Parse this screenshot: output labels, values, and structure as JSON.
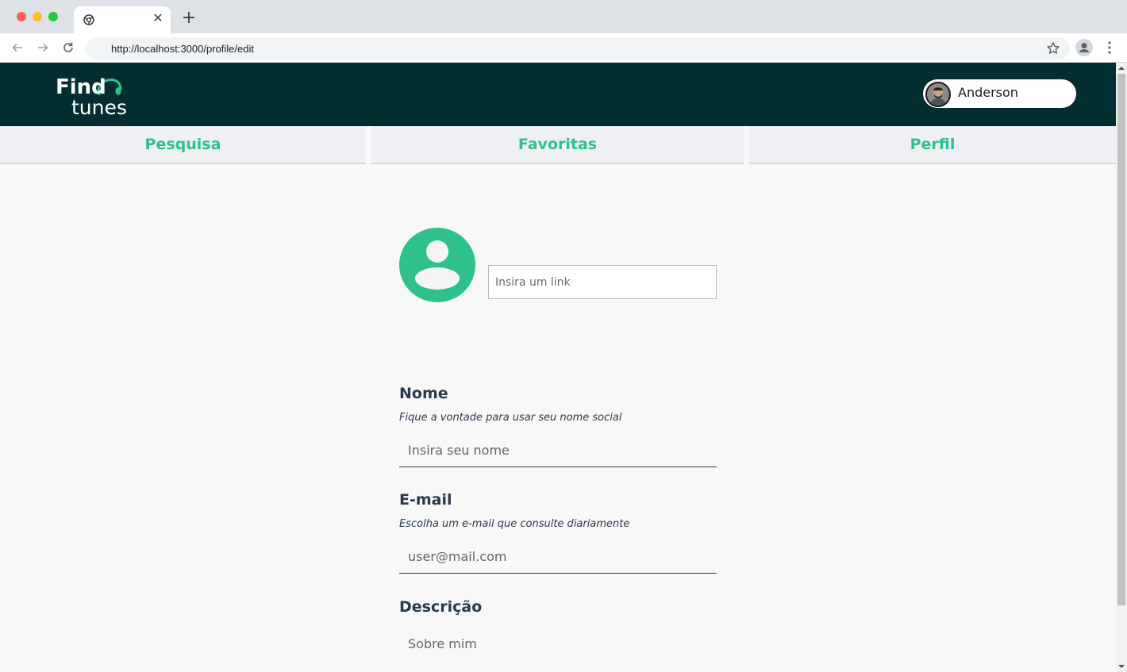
{
  "browser": {
    "url": "http://localhost:3000/profile/edit",
    "tab_close": "✕",
    "new_tab": "+"
  },
  "header": {
    "logo_line1": "Find",
    "logo_line2": "tunes",
    "user_name": "Anderson"
  },
  "nav": {
    "items": [
      {
        "label": "Pesquisa"
      },
      {
        "label": "Favoritas"
      },
      {
        "label": "Perfil"
      }
    ]
  },
  "form": {
    "image_link_placeholder": "Insira um link",
    "name": {
      "label": "Nome",
      "hint": "Fique a vontade para usar seu nome social",
      "placeholder": "Insira seu nome"
    },
    "email": {
      "label": "E-mail",
      "hint": "Escolha um e-mail que consulte diariamente",
      "placeholder": "user@mail.com"
    },
    "description": {
      "label": "Descrição",
      "placeholder": "Sobre mim"
    }
  },
  "colors": {
    "header_bg": "#032e31",
    "accent": "#2fc18c",
    "nav_bg": "#eff0f3",
    "page_bg": "#f8f8f8",
    "label_text": "#2b3a4a"
  }
}
